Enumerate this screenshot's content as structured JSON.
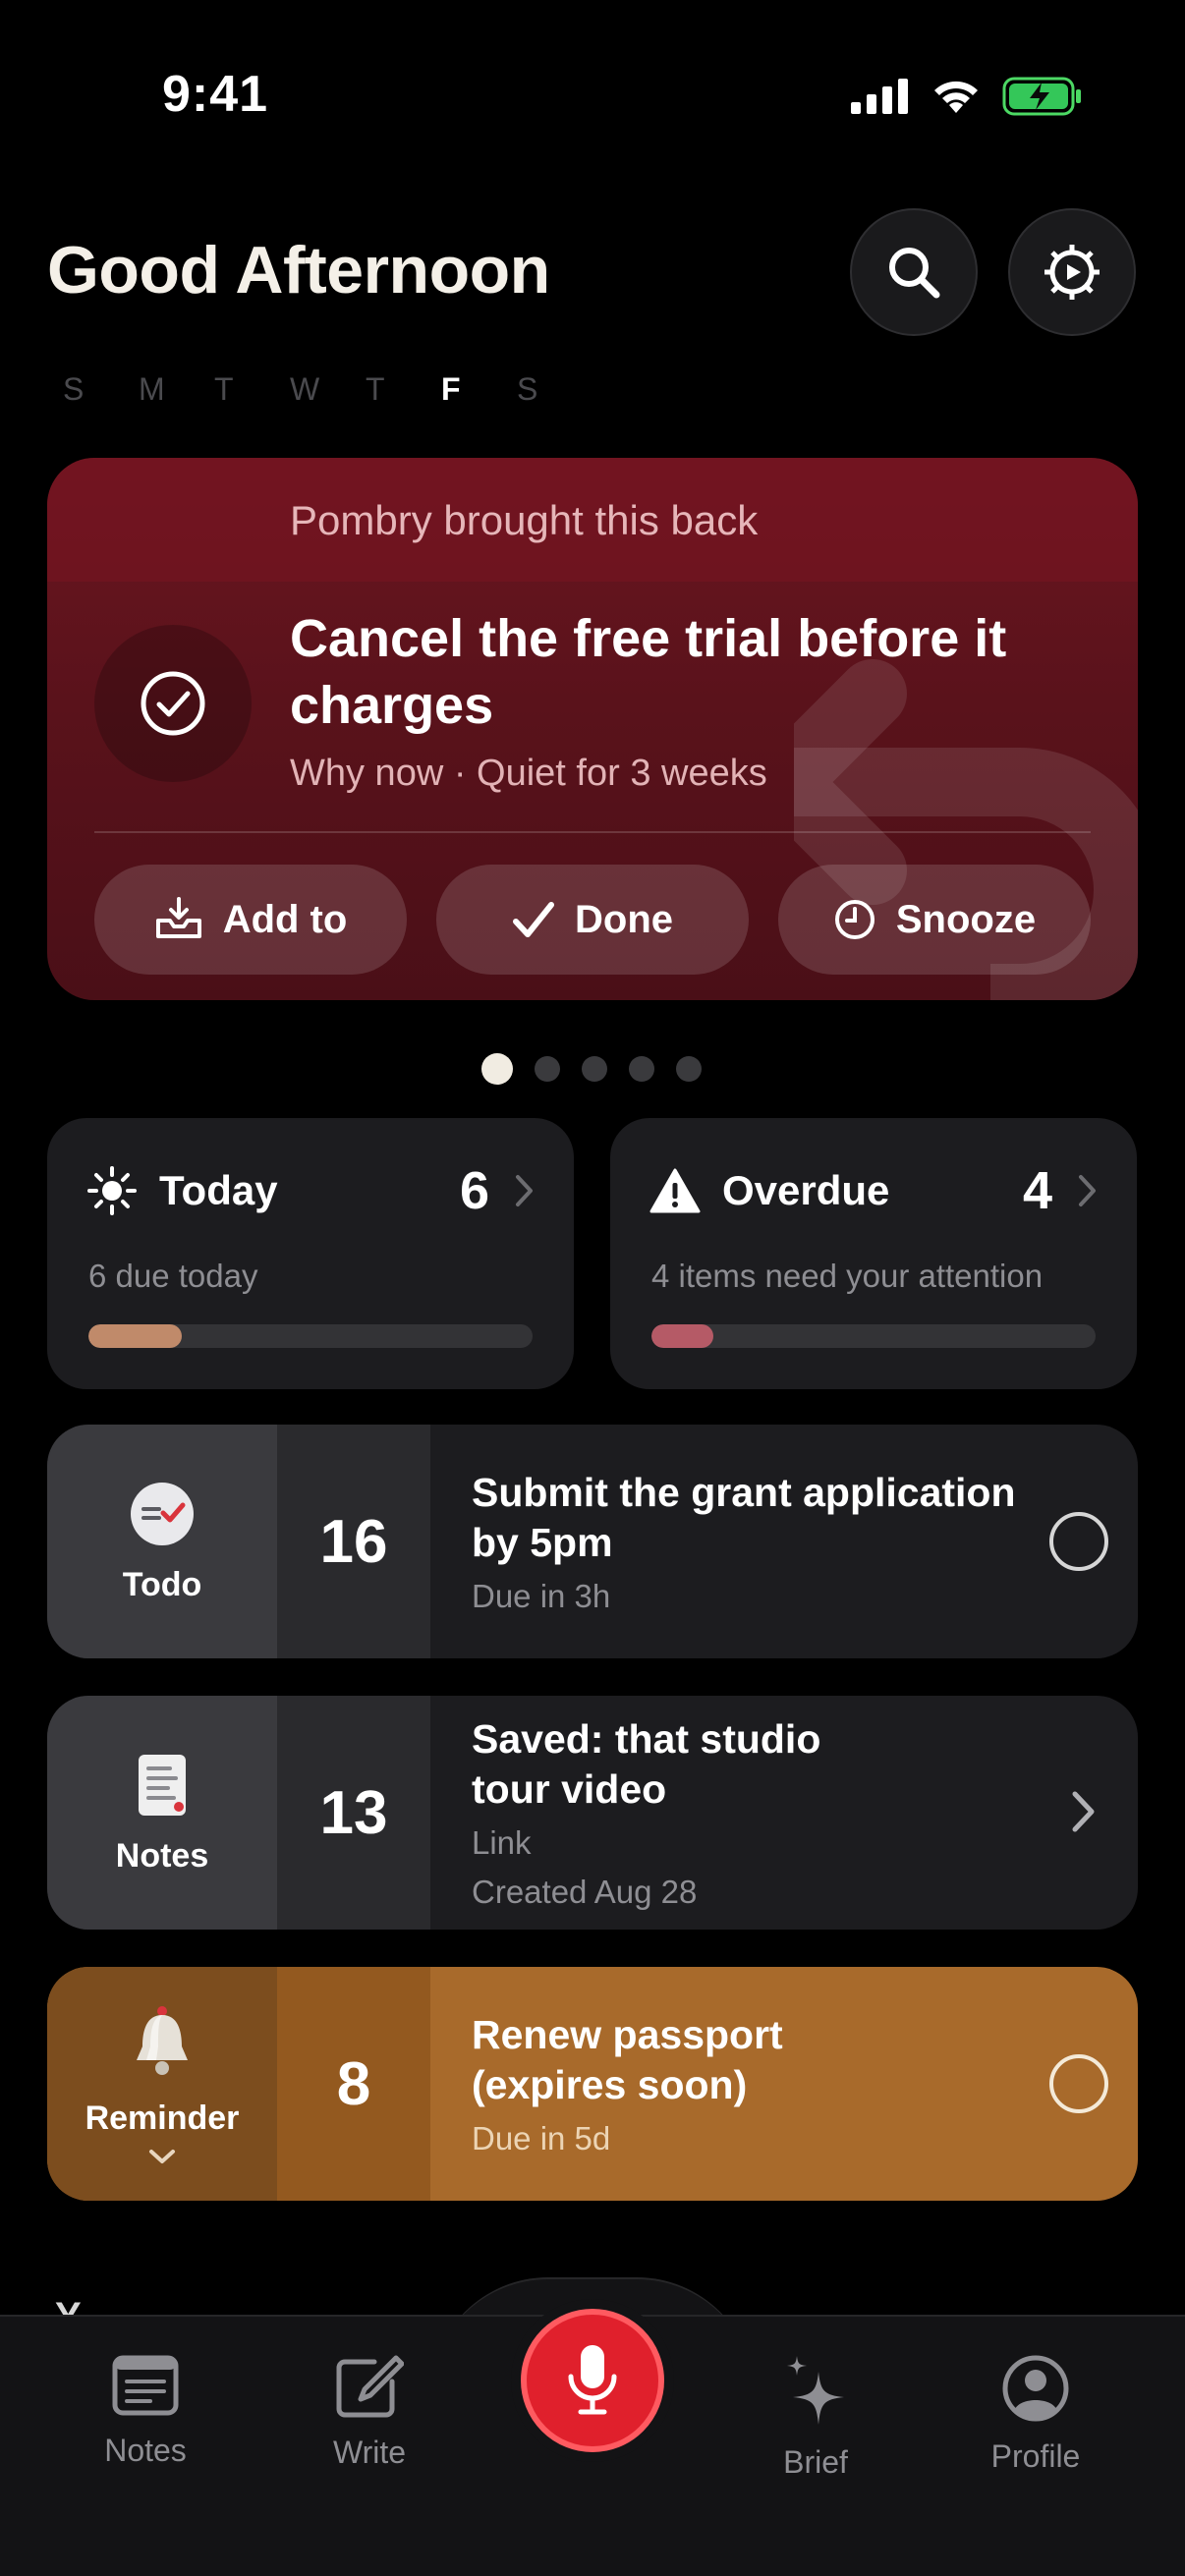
{
  "status": {
    "time": "9:41"
  },
  "header": {
    "greeting": "Good Afternoon",
    "weekdays": [
      "S",
      "M",
      "T",
      "W",
      "T",
      "F",
      "S"
    ],
    "active_weekday_index": 5
  },
  "hero": {
    "kicker": "Pombry brought this back",
    "title": "Cancel the free trial before it charges",
    "subtitle": "Why now · Quiet for 3 weeks",
    "actions": [
      {
        "label": "Add to",
        "icon": "tray-download-icon"
      },
      {
        "label": "Done",
        "icon": "checkmark-icon"
      },
      {
        "label": "Snooze",
        "icon": "clock-icon"
      }
    ],
    "color": "#6b1620"
  },
  "pager": {
    "count": 5,
    "active": 0
  },
  "summary": {
    "today": {
      "title": "Today",
      "count": "6",
      "subtitle": "6 due today",
      "progress": 0.21,
      "color": "#c08a6a"
    },
    "overdue": {
      "title": "Overdue",
      "count": "4",
      "subtitle": "4 items need your attention",
      "progress": 0.14,
      "color": "#b55a66"
    }
  },
  "rows": [
    {
      "kind": "Todo",
      "count": "16",
      "title": "Submit the grant application by 5pm",
      "sub": "Due in 3h",
      "sub2": ""
    },
    {
      "kind": "Notes",
      "count": "13",
      "title": "Saved: that studio tour video",
      "sub": "Link",
      "sub2": "Created Aug 28"
    },
    {
      "kind": "Reminder",
      "count": "8",
      "title": "Renew passport (expires soon)",
      "sub": "Due in 5d",
      "sub2": "",
      "color": "#a86a2b"
    }
  ],
  "tabbar": {
    "tabs": [
      {
        "label": "Notes",
        "icon": "notes-icon"
      },
      {
        "label": "Write",
        "icon": "compose-icon"
      },
      {
        "label": "Brief",
        "icon": "sparkles-icon"
      },
      {
        "label": "Profile",
        "icon": "profile-icon"
      }
    ],
    "mic_color": "#e0202c"
  }
}
